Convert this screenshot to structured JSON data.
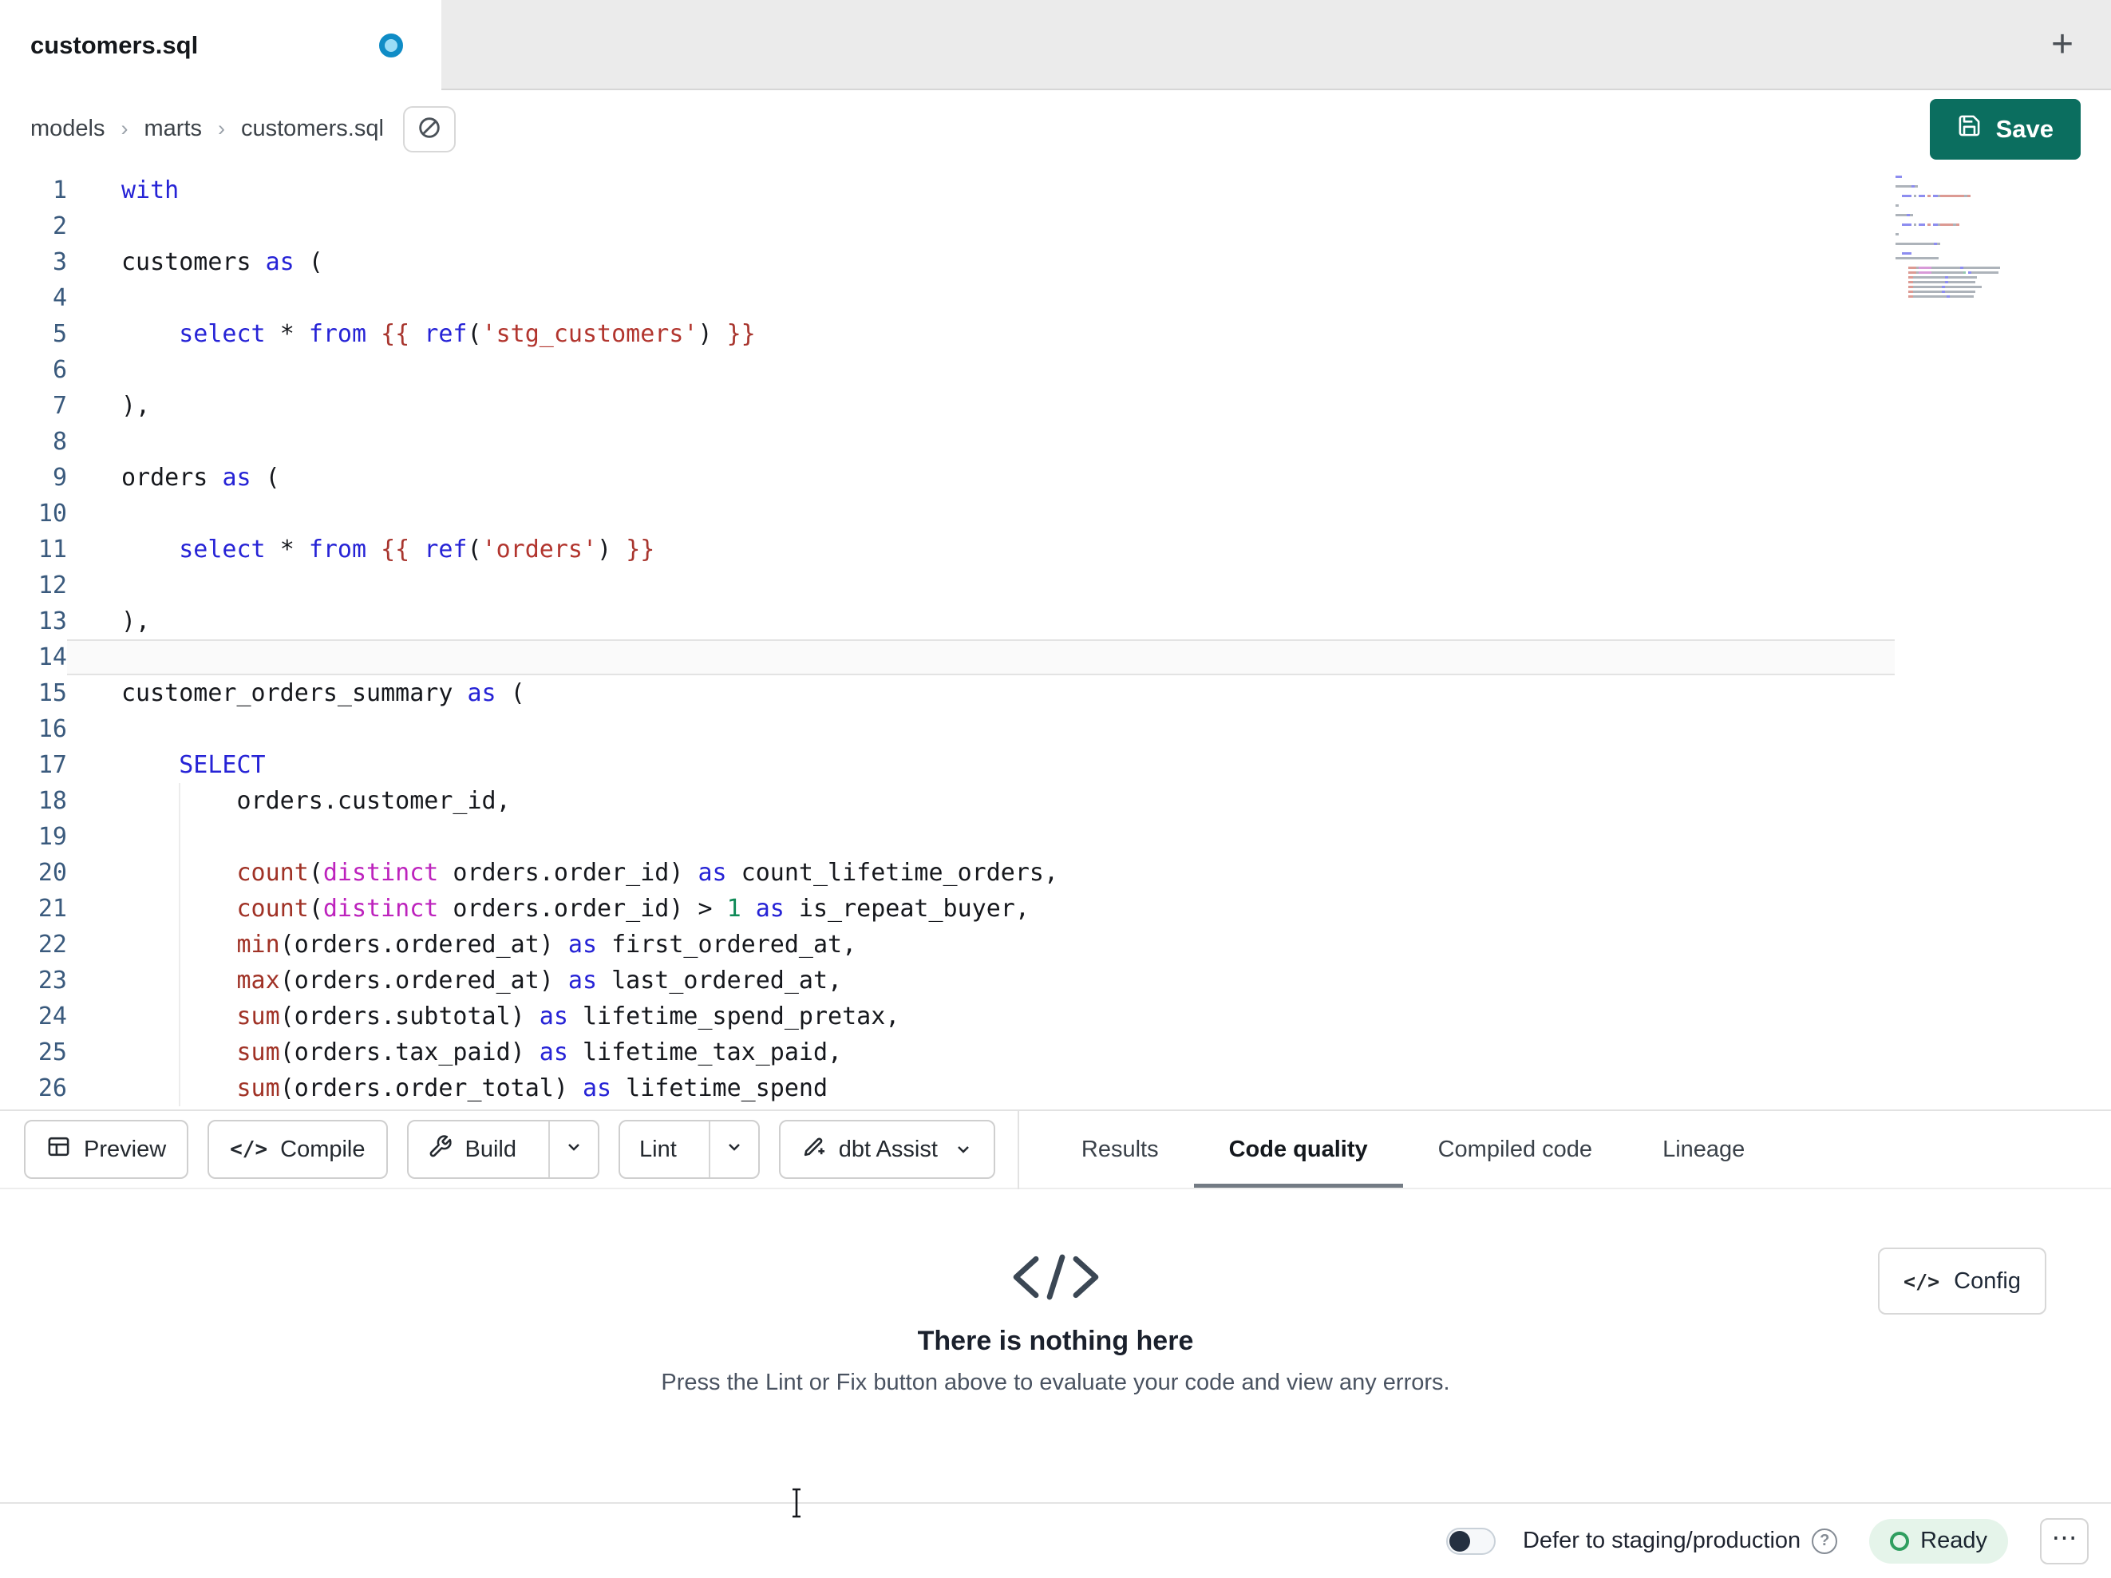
{
  "window": {
    "tab_title": "customers.sql",
    "new_tab_label": "+"
  },
  "breadcrumb": {
    "items": [
      "models",
      "marts",
      "customers.sql"
    ],
    "separator": "›"
  },
  "header": {
    "save_label": "Save"
  },
  "editor": {
    "lines": [
      {
        "n": 1,
        "s": [
          [
            "kw",
            "with"
          ]
        ]
      },
      {
        "n": 2,
        "s": []
      },
      {
        "n": 3,
        "s": [
          [
            "pl",
            "customers "
          ],
          [
            "kw",
            "as"
          ],
          [
            "pl",
            " ("
          ]
        ]
      },
      {
        "n": 4,
        "s": []
      },
      {
        "n": 5,
        "s": [
          [
            "pl",
            "    "
          ],
          [
            "kw",
            "select"
          ],
          [
            "pl",
            " "
          ],
          [
            "op",
            "*"
          ],
          [
            "pl",
            " "
          ],
          [
            "kw",
            "from"
          ],
          [
            "pl",
            " "
          ],
          [
            "jj",
            "{{"
          ],
          [
            "pl",
            " "
          ],
          [
            "kw",
            "ref"
          ],
          [
            "pl",
            "("
          ],
          [
            "st",
            "'stg_customers'"
          ],
          [
            "pl",
            ") "
          ],
          [
            "jj",
            "}}"
          ]
        ]
      },
      {
        "n": 6,
        "s": []
      },
      {
        "n": 7,
        "s": [
          [
            "pl",
            "),"
          ]
        ]
      },
      {
        "n": 8,
        "s": []
      },
      {
        "n": 9,
        "s": [
          [
            "pl",
            "orders "
          ],
          [
            "kw",
            "as"
          ],
          [
            "pl",
            " ("
          ]
        ]
      },
      {
        "n": 10,
        "s": []
      },
      {
        "n": 11,
        "s": [
          [
            "pl",
            "    "
          ],
          [
            "kw",
            "select"
          ],
          [
            "pl",
            " "
          ],
          [
            "op",
            "*"
          ],
          [
            "pl",
            " "
          ],
          [
            "kw",
            "from"
          ],
          [
            "pl",
            " "
          ],
          [
            "jj",
            "{{"
          ],
          [
            "pl",
            " "
          ],
          [
            "kw",
            "ref"
          ],
          [
            "pl",
            "("
          ],
          [
            "st",
            "'orders'"
          ],
          [
            "pl",
            ") "
          ],
          [
            "jj",
            "}}"
          ]
        ]
      },
      {
        "n": 12,
        "s": []
      },
      {
        "n": 13,
        "s": [
          [
            "pl",
            "),"
          ]
        ]
      },
      {
        "n": 14,
        "s": [],
        "active": true
      },
      {
        "n": 15,
        "s": [
          [
            "pl",
            "customer_orders_summary "
          ],
          [
            "kw",
            "as"
          ],
          [
            "pl",
            " ("
          ]
        ]
      },
      {
        "n": 16,
        "s": []
      },
      {
        "n": 17,
        "s": [
          [
            "pl",
            "    "
          ],
          [
            "kw",
            "SELECT"
          ]
        ]
      },
      {
        "n": 18,
        "s": [
          [
            "pl",
            "        orders.customer_id,"
          ]
        ],
        "guide": true
      },
      {
        "n": 19,
        "s": [],
        "guide": true
      },
      {
        "n": 20,
        "s": [
          [
            "pl",
            "        "
          ],
          [
            "fn",
            "count"
          ],
          [
            "pl",
            "("
          ],
          [
            "mg",
            "distinct"
          ],
          [
            "pl",
            " orders.order_id) "
          ],
          [
            "kw",
            "as"
          ],
          [
            "pl",
            " count_lifetime_orders,"
          ]
        ],
        "guide": true
      },
      {
        "n": 21,
        "s": [
          [
            "pl",
            "        "
          ],
          [
            "fn",
            "count"
          ],
          [
            "pl",
            "("
          ],
          [
            "mg",
            "distinct"
          ],
          [
            "pl",
            " orders.order_id) > "
          ],
          [
            "nm",
            "1"
          ],
          [
            "pl",
            " "
          ],
          [
            "kw",
            "as"
          ],
          [
            "pl",
            " is_repeat_buyer,"
          ]
        ],
        "guide": true
      },
      {
        "n": 22,
        "s": [
          [
            "pl",
            "        "
          ],
          [
            "fn",
            "min"
          ],
          [
            "pl",
            "(orders.ordered_at) "
          ],
          [
            "kw",
            "as"
          ],
          [
            "pl",
            " first_ordered_at,"
          ]
        ],
        "guide": true
      },
      {
        "n": 23,
        "s": [
          [
            "pl",
            "        "
          ],
          [
            "fn",
            "max"
          ],
          [
            "pl",
            "(orders.ordered_at) "
          ],
          [
            "kw",
            "as"
          ],
          [
            "pl",
            " last_ordered_at,"
          ]
        ],
        "guide": true
      },
      {
        "n": 24,
        "s": [
          [
            "pl",
            "        "
          ],
          [
            "fn",
            "sum"
          ],
          [
            "pl",
            "(orders.subtotal) "
          ],
          [
            "kw",
            "as"
          ],
          [
            "pl",
            " lifetime_spend_pretax,"
          ]
        ],
        "guide": true
      },
      {
        "n": 25,
        "s": [
          [
            "pl",
            "        "
          ],
          [
            "fn",
            "sum"
          ],
          [
            "pl",
            "(orders.tax_paid) "
          ],
          [
            "kw",
            "as"
          ],
          [
            "pl",
            " lifetime_tax_paid,"
          ]
        ],
        "guide": true
      },
      {
        "n": 26,
        "s": [
          [
            "pl",
            "        "
          ],
          [
            "fn",
            "sum"
          ],
          [
            "pl",
            "(orders.order_total) "
          ],
          [
            "kw",
            "as"
          ],
          [
            "pl",
            " lifetime_spend"
          ]
        ],
        "guide": true
      }
    ]
  },
  "toolbar": {
    "preview_label": "Preview",
    "compile_label": "Compile",
    "build_label": "Build",
    "lint_label": "Lint",
    "assist_label": "dbt Assist",
    "compile_glyph": "</>",
    "tabs": [
      {
        "label": "Results",
        "active": false
      },
      {
        "label": "Code quality",
        "active": true
      },
      {
        "label": "Compiled code",
        "active": false
      },
      {
        "label": "Lineage",
        "active": false
      }
    ]
  },
  "panel": {
    "title": "There is nothing here",
    "subtitle": "Press the Lint or Fix button above to evaluate your code and view any errors.",
    "config_label": "Config",
    "config_glyph": "</>"
  },
  "statusbar": {
    "defer_label": "Defer to staging/production",
    "help_label": "?",
    "ready_label": "Ready",
    "more_label": "⋯"
  },
  "colors": {
    "save_button": "#0b6e5f",
    "keyword_blue": "#2623d6",
    "string_red": "#b2352e",
    "function_red": "#a03226",
    "distinct_magenta": "#bd23bd",
    "number_green": "#0f8a57",
    "ready_green": "#2f9e5f",
    "unsaved_dot_blue": "#0f8cc6"
  }
}
